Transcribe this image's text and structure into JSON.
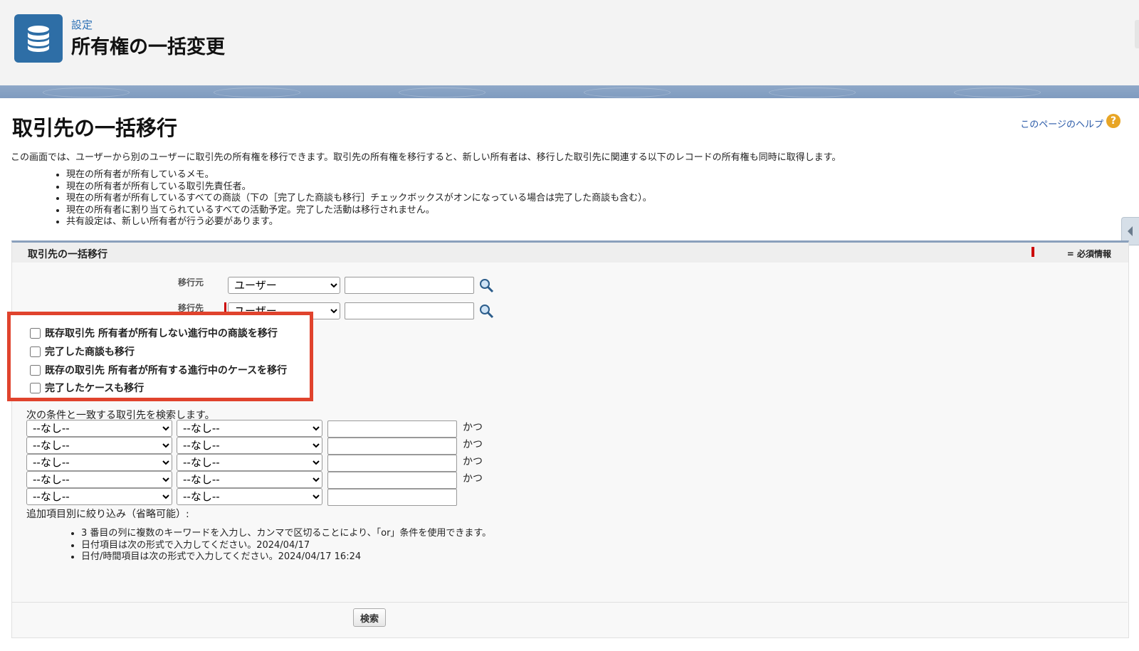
{
  "header": {
    "breadcrumb": "設定",
    "title": "所有権の一括変更"
  },
  "page": {
    "heading": "取引先の一括移行",
    "help_link": "このページのヘルプ",
    "intro": "この画面では、ユーザーから別のユーザーに取引先の所有権を移行できます。取引先の所有権を移行すると、新しい所有者は、移行した取引先に関連する以下のレコードの所有権も同時に取得します。",
    "bullets": [
      "現在の所有者が所有しているメモ。",
      "現在の所有者が所有している取引先責任者。",
      "現在の所有者が所有しているすべての商談（下の［完了した商談も移行］チェックボックスがオンになっている場合は完了した商談も含む）。",
      "現在の所有者に割り当てられているすべての活動予定。完了した活動は移行されません。",
      "共有設定は、新しい所有者が行う必要があります。"
    ]
  },
  "section": {
    "title": "取引先の一括移行",
    "required_note": "= 必須情報",
    "from_label": "移行元",
    "to_label": "移行先",
    "from_type": "ユーザー",
    "to_type": "ユーザー",
    "from_value": "",
    "to_value": ""
  },
  "checkboxes": [
    {
      "label": "既存取引先 所有者が所有しない進行中の商談を移行",
      "checked": false
    },
    {
      "label": "完了した商談も移行",
      "checked": false
    },
    {
      "label": "既存の取引先 所有者が所有する進行中のケースを移行",
      "checked": false
    },
    {
      "label": "完了したケースも移行",
      "checked": false
    }
  ],
  "filter": {
    "title": "次の条件と一致する取引先を検索します。",
    "none_option": "--なし--",
    "and_label": "かつ",
    "optional_title": "追加項目別に絞り込み（省略可能）:",
    "tips": [
      "3 番目の列に複数のキーワードを入力し、カンマで区切ることにより、「or」条件を使用できます。",
      "日付項目は次の形式で入力してください。2024/04/17",
      "日付/時間項目は次の形式で入力してください。2024/04/17 16:24"
    ]
  },
  "buttons": {
    "search": "検索"
  },
  "colors": {
    "highlight": "#e0432d",
    "app_icon": "#2e6ea6",
    "required": "#cc0000"
  }
}
